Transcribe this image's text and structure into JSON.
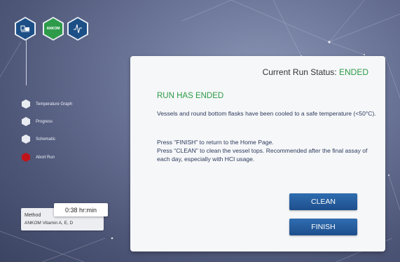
{
  "header": {
    "logo_text": "ANKOM"
  },
  "sidebar": {
    "items": [
      {
        "label": "Temperature Graph",
        "icon": "hexagon-outline-icon"
      },
      {
        "label": "Progress",
        "icon": "hexagon-outline-icon"
      },
      {
        "label": "Schematic",
        "icon": "hexagon-outline-icon"
      },
      {
        "label": "Abort Run",
        "icon": "hexagon-red-icon"
      }
    ]
  },
  "method": {
    "label": "Method",
    "name": "ANKOM Vitamin A, E, D",
    "timer": "0:38 hr:min"
  },
  "panel": {
    "status_label": "Current Run Status:",
    "status_value": "ENDED",
    "heading": "RUN HAS ENDED",
    "para1": "Vessels and round bottom flasks have been cooled to a safe temperature (<50°C).",
    "para2_line1": "Press “FINISH” to return to the Home Page.",
    "para2_line2": "Press “CLEAN” to clean the vessel tops. Recommended after the final assay of each day, especially with HCl usage.",
    "clean_label": "CLEAN",
    "finish_label": "FINISH"
  },
  "colors": {
    "accent_green": "#2a9a45",
    "button_blue": "#1d4e8c",
    "abort_red": "#c0141b"
  }
}
